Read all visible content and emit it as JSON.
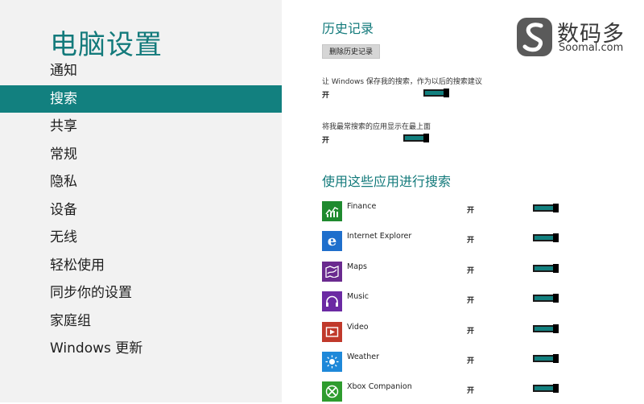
{
  "sidebar": {
    "title": "电脑设置",
    "items": [
      {
        "label": "通知",
        "active": false
      },
      {
        "label": "搜索",
        "active": true
      },
      {
        "label": "共享",
        "active": false
      },
      {
        "label": "常规",
        "active": false
      },
      {
        "label": "隐私",
        "active": false
      },
      {
        "label": "设备",
        "active": false
      },
      {
        "label": "无线",
        "active": false
      },
      {
        "label": "轻松使用",
        "active": false
      },
      {
        "label": "同步你的设置",
        "active": false
      },
      {
        "label": "家庭组",
        "active": false
      },
      {
        "label": "Windows 更新",
        "active": false
      }
    ]
  },
  "history": {
    "heading": "历史记录",
    "delete_button": "删除历史记录",
    "setting1_label": "让 Windows 保存我的搜索，作为以后的搜索建议",
    "setting1_state": "开",
    "setting2_label": "将我最常搜索的应用显示在最上面",
    "setting2_state": "开"
  },
  "apps": {
    "heading": "使用这些应用进行搜索",
    "list": [
      {
        "name": "Finance",
        "state": "开",
        "color": "#1f8a2f",
        "icon": "finance-icon"
      },
      {
        "name": "Internet Explorer",
        "state": "开",
        "color": "#1f6fcc",
        "icon": "internet-explorer-icon"
      },
      {
        "name": "Maps",
        "state": "开",
        "color": "#6a2a8f",
        "icon": "maps-icon"
      },
      {
        "name": "Music",
        "state": "开",
        "color": "#6b2aa3",
        "icon": "music-icon"
      },
      {
        "name": "Video",
        "state": "开",
        "color": "#c0392b",
        "icon": "video-icon"
      },
      {
        "name": "Weather",
        "state": "开",
        "color": "#1e88d9",
        "icon": "weather-icon"
      },
      {
        "name": "Xbox Companion",
        "state": "开",
        "color": "#2e9c2e",
        "icon": "xbox-companion-icon"
      }
    ]
  },
  "watermark": {
    "text": "数码多",
    "sub": "Soomal.com"
  },
  "colors": {
    "accent": "#12807f",
    "title": "#137a7b",
    "sidebar_bg": "#f2f2f2"
  }
}
